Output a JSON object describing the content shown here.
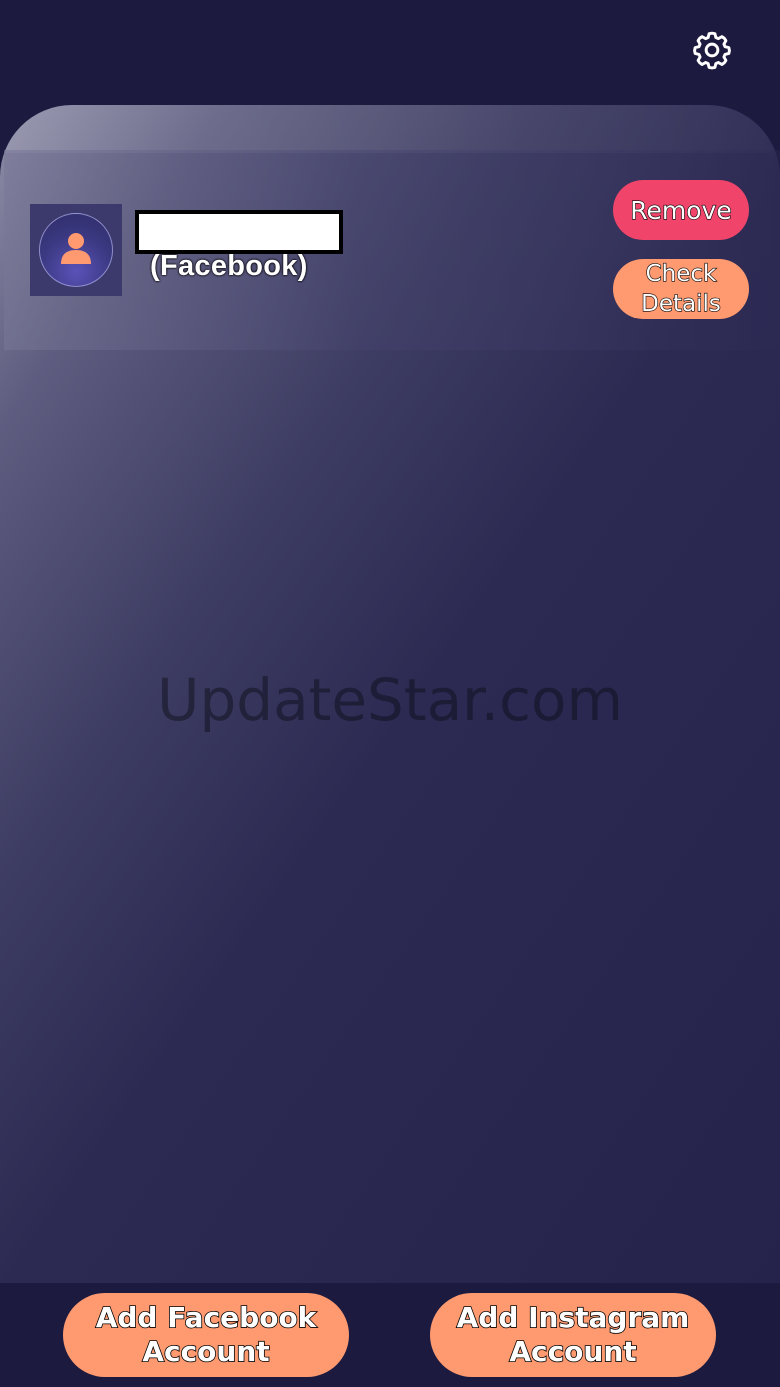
{
  "header": {
    "settings_icon": "gear-icon"
  },
  "accounts": [
    {
      "avatar_icon": "user-icon",
      "name": "",
      "platform": "(Facebook)",
      "remove_label": "Remove",
      "details_label": "Check\nDetails"
    }
  ],
  "watermark": "UpdateStar.com",
  "footer": {
    "add_facebook_label": "Add Facebook\nAccount",
    "add_instagram_label": "Add Instagram\nAccount"
  },
  "colors": {
    "background": "#1c1a3e",
    "remove_button": "#f0446a",
    "accent_button": "#ff9a70",
    "avatar_figure": "#ff9a70"
  }
}
